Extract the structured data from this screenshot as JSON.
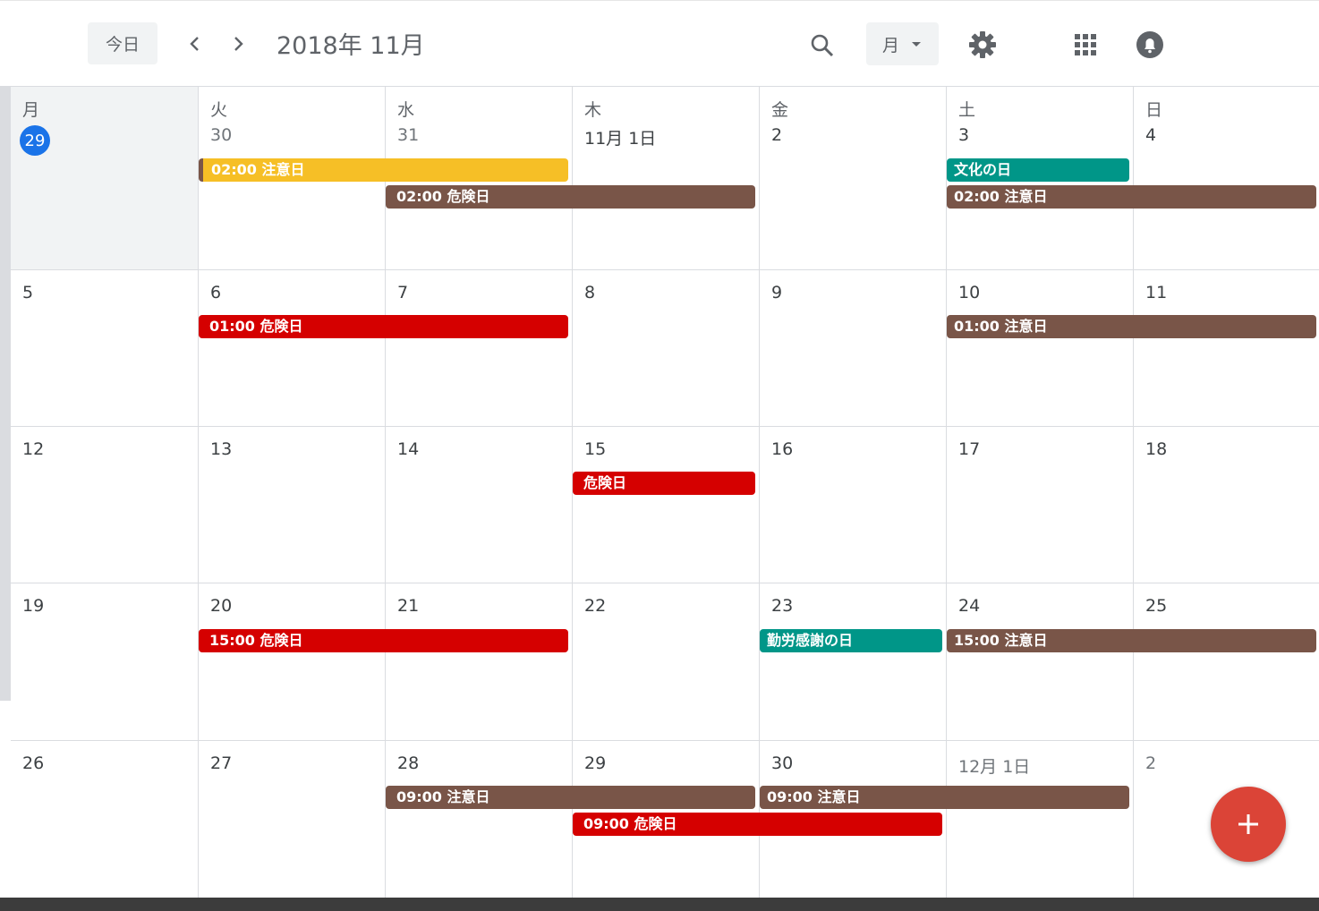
{
  "header": {
    "today_label": "今日",
    "month_title": "2018年 11月",
    "view_label": "月",
    "icons": [
      "chevron-left-icon",
      "chevron-right-icon",
      "search-icon",
      "gear-icon",
      "apps-grid-icon",
      "bell-icon"
    ]
  },
  "weekdays": [
    "月",
    "火",
    "水",
    "木",
    "金",
    "土",
    "日"
  ],
  "weeks": [
    [
      "29",
      "30",
      "31",
      "11月 1日",
      "2",
      "3",
      "4"
    ],
    [
      "5",
      "6",
      "7",
      "8",
      "9",
      "10",
      "11"
    ],
    [
      "12",
      "13",
      "14",
      "15",
      "16",
      "17",
      "18"
    ],
    [
      "19",
      "20",
      "21",
      "22",
      "23",
      "24",
      "25"
    ],
    [
      "26",
      "27",
      "28",
      "29",
      "30",
      "12月 1日",
      "2"
    ]
  ],
  "events": [
    {
      "label": "02:00 注意日",
      "color": "#f6bf26"
    },
    {
      "label": "02:00 危険日",
      "color": "#795548"
    },
    {
      "label": "文化の日",
      "color": "#009688"
    },
    {
      "label": "02:00 注意日",
      "color": "#795548"
    },
    {
      "label": "01:00 危険日",
      "color": "#d50000"
    },
    {
      "label": "01:00 注意日",
      "color": "#795548"
    },
    {
      "label": "危険日",
      "color": "#d50000"
    },
    {
      "label": "15:00 危険日",
      "color": "#d50000"
    },
    {
      "label": "勤労感謝の日",
      "color": "#009688"
    },
    {
      "label": "15:00 注意日",
      "color": "#795548"
    },
    {
      "label": "09:00 注意日",
      "color": "#795548"
    },
    {
      "label": "09:00 注意日",
      "color": "#795548"
    },
    {
      "label": "09:00 危険日",
      "color": "#d50000"
    }
  ],
  "fab_icon": "plus-icon"
}
